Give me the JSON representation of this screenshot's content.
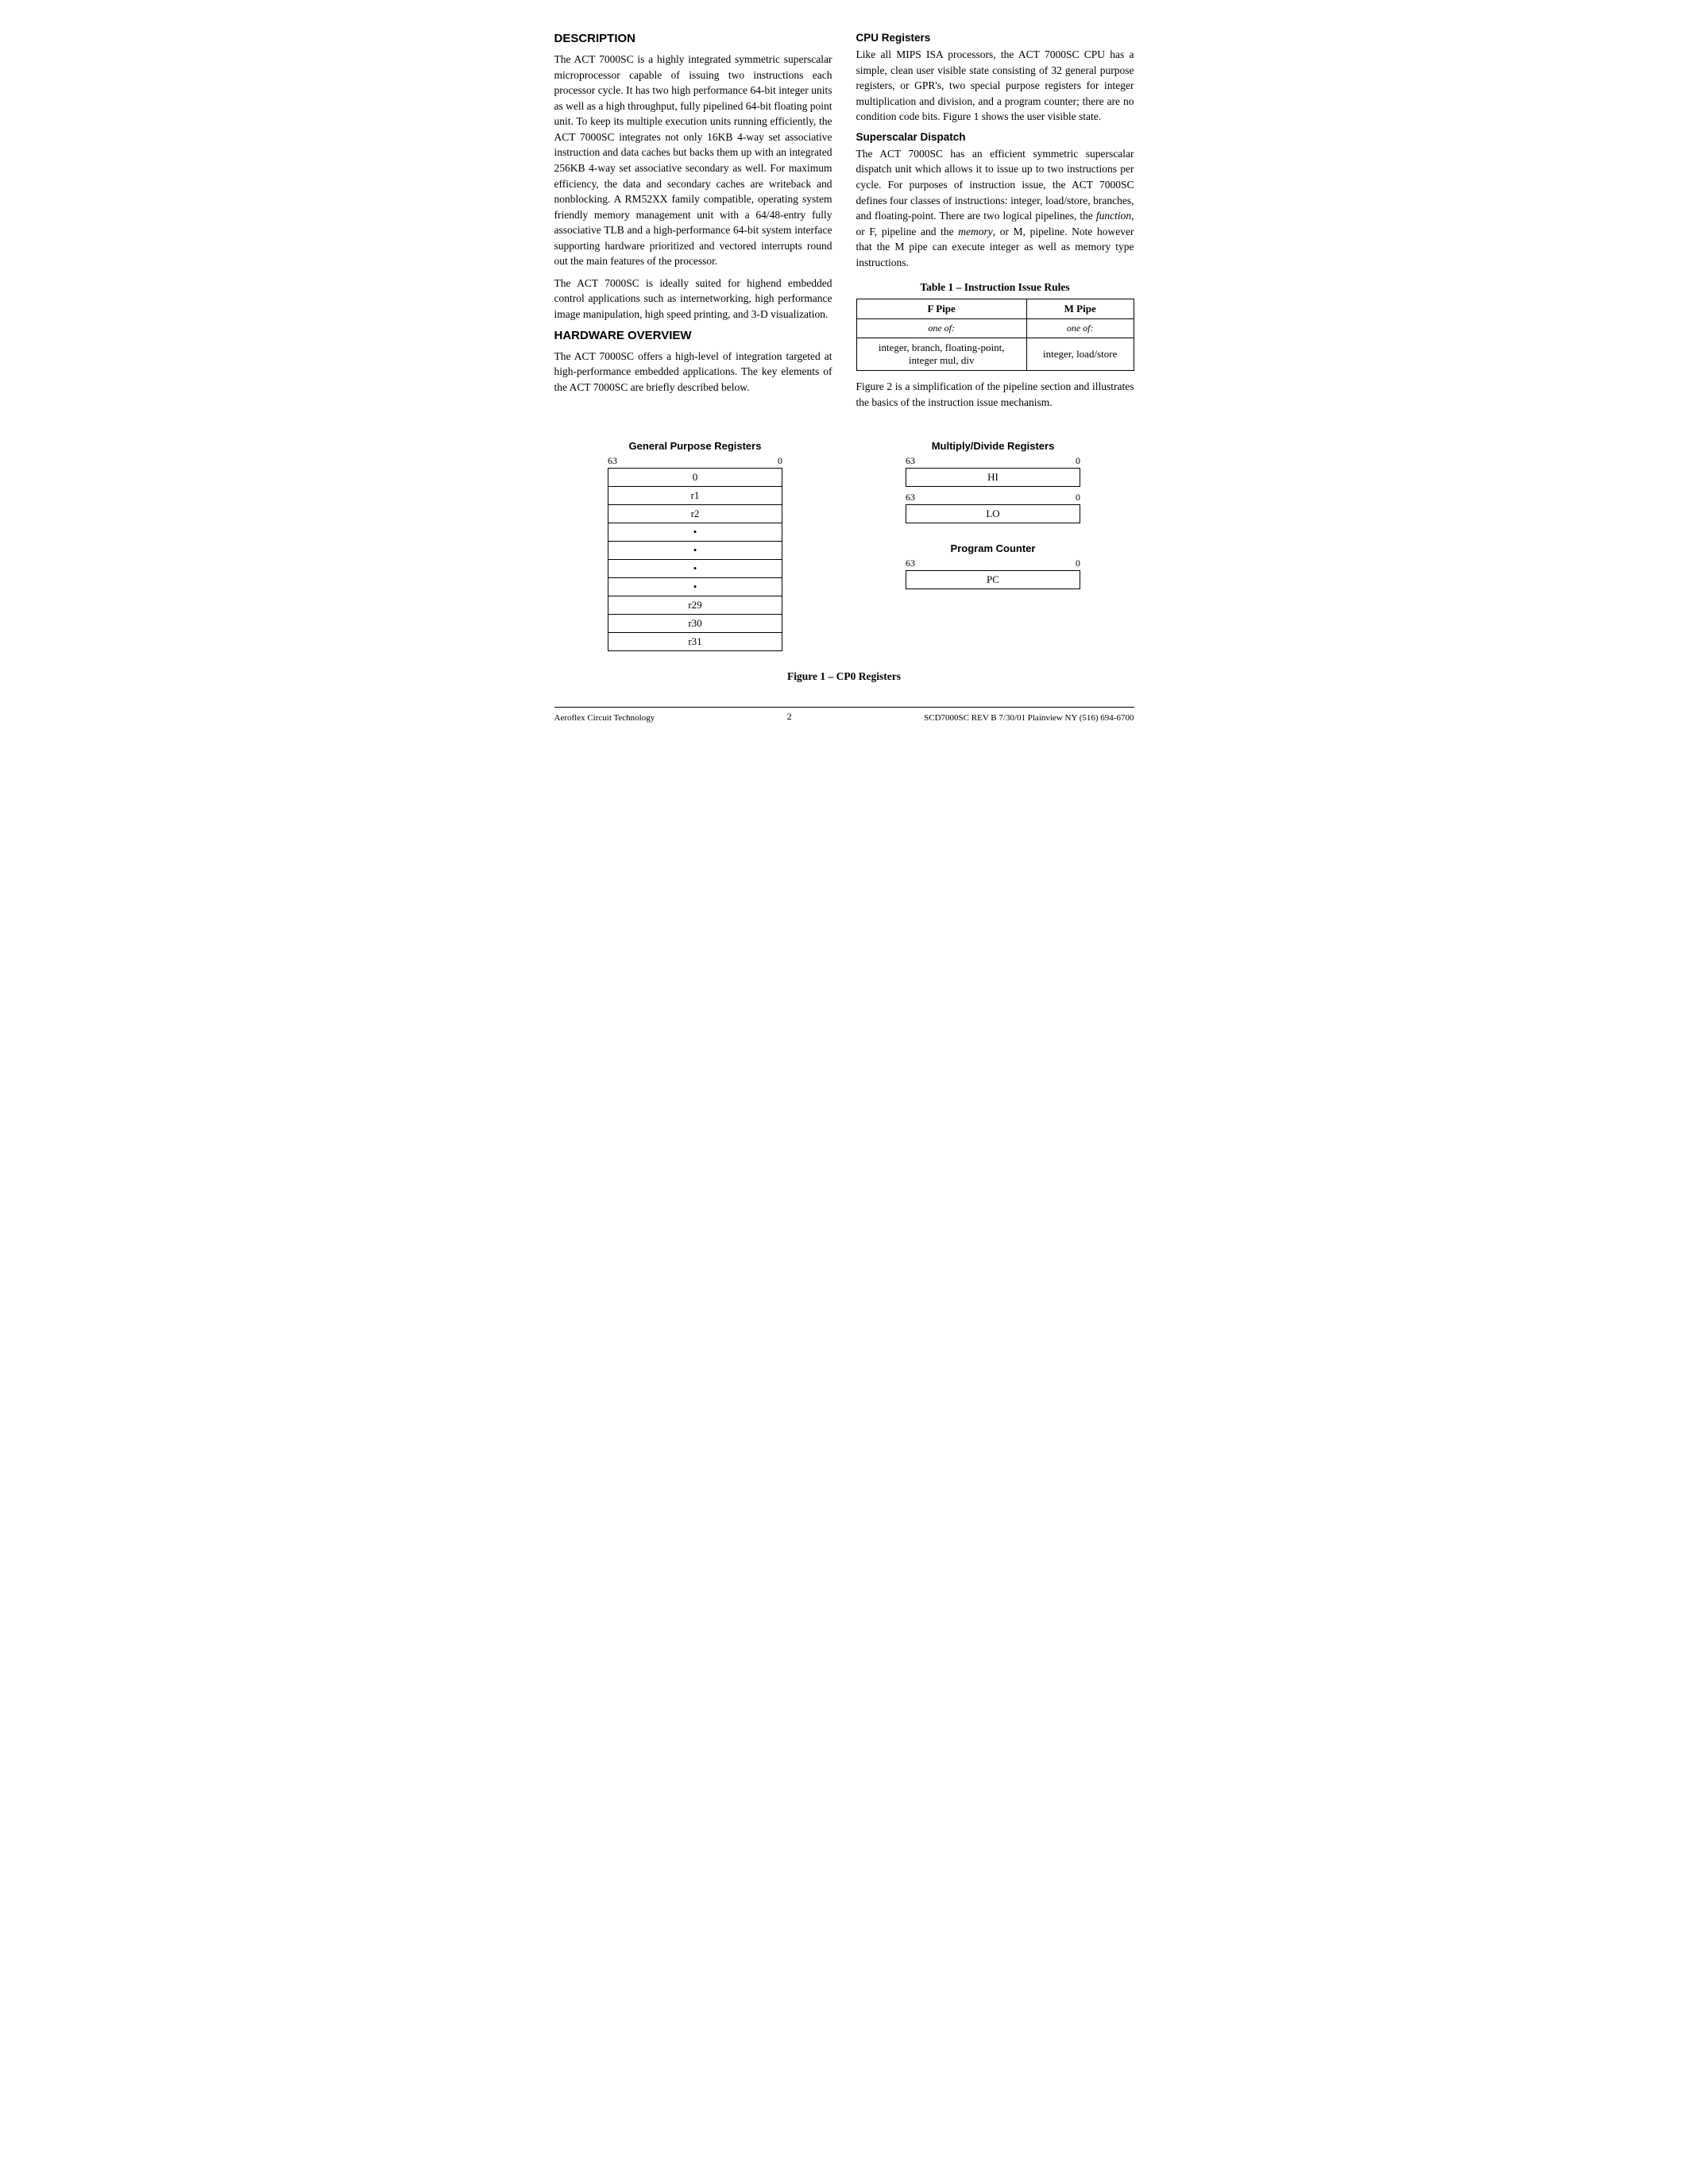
{
  "sections": {
    "description": {
      "title": "DESCRIPTION",
      "paragraphs": [
        "The ACT 7000SC is a highly integrated symmetric superscalar microprocessor capable of issuing two instructions each processor cycle. It has two high performance 64-bit integer units as well as a high throughput, fully pipelined 64-bit floating point unit. To keep its multiple execution units running efficiently, the ACT 7000SC integrates not only 16KB 4-way set associative instruction and data caches but backs them up with an integrated 256KB 4-way set associative secondary as well. For maximum efficiency, the data and secondary caches are writeback and nonblocking. A RM52XX family compatible, operating system friendly memory management unit with a 64/48-entry fully associative TLB and a high-performance 64-bit system interface supporting hardware prioritized and vectored interrupts round out the main features of the processor.",
        "The ACT 7000SC is ideally suited for highend embedded control applications such as internetworking, high performance image manipulation, high speed printing, and 3-D visualization."
      ]
    },
    "hardware_overview": {
      "title": "HARDWARE OVERVIEW",
      "paragraphs": [
        "The ACT 7000SC offers a high-level of integration targeted at high-performance embedded applications. The key elements of the ACT 7000SC are briefly described below."
      ]
    },
    "cpu_registers": {
      "title": "CPU Registers",
      "paragraphs": [
        "Like all MIPS ISA processors, the ACT 7000SC CPU has a simple, clean user visible state consisting of 32 general purpose registers, or GPR's, two special purpose registers for integer multiplication and division, and a program counter; there are no condition code bits. Figure 1 shows the user visible state."
      ]
    },
    "superscalar_dispatch": {
      "title": "Superscalar Dispatch",
      "paragraphs": [
        "The ACT 7000SC has an efficient symmetric superscalar dispatch unit which allows it to issue up to two instructions per cycle. For purposes of instruction issue, the ACT 7000SC defines four classes of instructions: integer, load/store, branches, and floating-point. There are two logical pipelines, the function, or F, pipeline and the memory, or M, pipeline. Note however that the M pipe can execute integer as well as memory type instructions.",
        "Figure 2 is a simplification of the pipeline section and illustrates the basics of the instruction issue mechanism."
      ]
    },
    "instruction_table": {
      "title": "Table 1 – Instruction Issue Rules",
      "headers": [
        "F Pipe",
        "M Pipe"
      ],
      "sub_headers": [
        "one of:",
        "one of:"
      ],
      "rows": [
        [
          "integer, branch, floating-point, integer mul, div",
          "integer, load/store"
        ]
      ]
    }
  },
  "diagrams": {
    "gpr": {
      "title": "General Purpose Registers",
      "bit_high": "63",
      "bit_low": "0",
      "rows": [
        "0",
        "r1",
        "r2",
        "•",
        "•",
        "•",
        "•",
        "r29",
        "r30",
        "r31"
      ]
    },
    "multiply_divide": {
      "title": "Multiply/Divide Registers",
      "hi": {
        "bit_high": "63",
        "bit_low": "0",
        "label": "HI"
      },
      "lo": {
        "bit_high": "63",
        "bit_low": "0",
        "label": "LO"
      }
    },
    "program_counter": {
      "title": "Program Counter",
      "bit_high": "63",
      "bit_low": "0",
      "label": "PC"
    }
  },
  "figure_caption": "Figure 1 – CP0 Registers",
  "footer": {
    "left": "Aeroflex Circuit Technology",
    "center": "2",
    "right": "SCD7000SC REV B  7/30/01  Plainview NY (516) 694-6700"
  }
}
